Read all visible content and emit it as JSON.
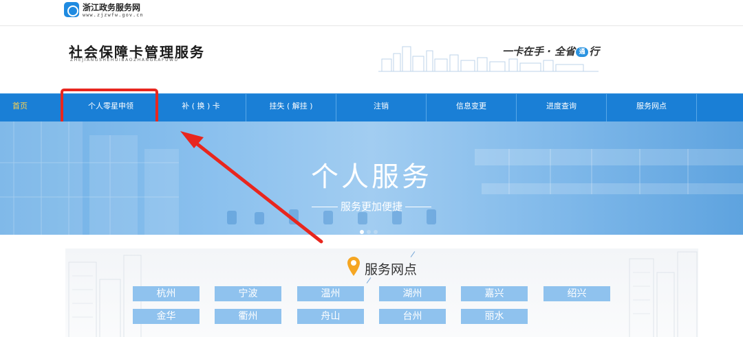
{
  "gov": {
    "name": "浙江政务服务网",
    "domain": "www.zjzwfw.gov.cn"
  },
  "header": {
    "title": "社会保障卡管理服务",
    "pinyin": "ZHEJIANGSHEHUIBAOZHANGKAFUWU",
    "slogan_left": "一卡在手 · 全省",
    "slogan_badge": "通",
    "slogan_right": "行"
  },
  "nav": {
    "items": [
      {
        "label": "首页"
      },
      {
        "label": "个人零星申领"
      },
      {
        "label": "补 ( 换 ) 卡"
      },
      {
        "label": "挂失 ( 解挂 )"
      },
      {
        "label": "注销"
      },
      {
        "label": "信息变更"
      },
      {
        "label": "进度查询"
      },
      {
        "label": "服务网点"
      }
    ]
  },
  "banner": {
    "title": "个人服务",
    "subtitle": "服务更加便捷"
  },
  "services": {
    "title": "服务网点",
    "cities": [
      "杭州",
      "宁波",
      "温州",
      "湖州",
      "嘉兴",
      "绍兴",
      "金华",
      "衢州",
      "舟山",
      "台州",
      "丽水"
    ]
  },
  "colors": {
    "nav_bg": "#1a7fd6",
    "home_text": "#ffd34d",
    "highlight": "#e8261e",
    "city_button": "#8fc2ee",
    "pin": "#f5a623"
  }
}
